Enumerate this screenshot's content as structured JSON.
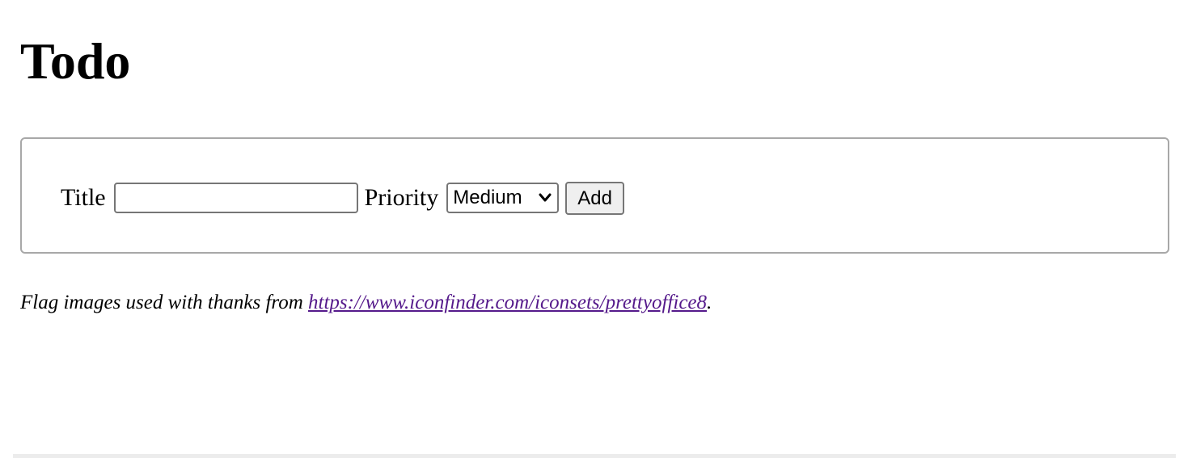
{
  "page": {
    "heading": "Todo"
  },
  "form": {
    "title_label": "Title",
    "title_value": "",
    "title_placeholder": "",
    "priority_label": "Priority",
    "priority_selected": "Medium",
    "add_label": "Add"
  },
  "credits": {
    "prefix": "Flag images used with thanks from ",
    "link_text": "https://www.iconfinder.com/iconsets/prettyoffice8",
    "suffix": "."
  },
  "colors": {
    "visited_link": "#551a8b",
    "border": "#a8a8a8",
    "button_bg": "#efefef"
  },
  "icons": {
    "select_arrow": "chevron-down-icon"
  }
}
